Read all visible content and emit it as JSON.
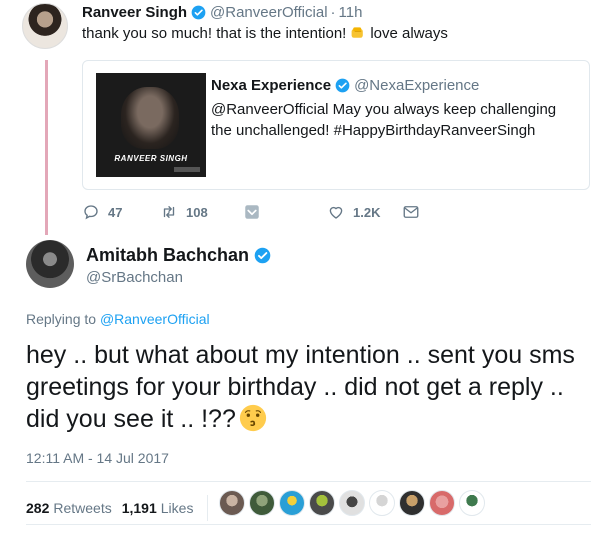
{
  "reply_tweet": {
    "name": "Ranveer Singh",
    "handle": "@RanveerOfficial",
    "separator": "·",
    "time": "11h",
    "text_before": "thank you so much! that is the intention!",
    "text_after": "love always"
  },
  "quoted_tweet": {
    "name": "Nexa Experience",
    "handle": "@NexaExperience",
    "text": "@RanveerOfficial May you always keep challenging the unchallenged! #HappyBirthdayRanveerSingh",
    "image_caption": "RANVEER SINGH"
  },
  "actions": {
    "reply_count": "47",
    "retweet_count": "108",
    "like_count": "1.2K"
  },
  "main_tweet": {
    "name": "Amitabh Bachchan",
    "handle": "@SrBachchan",
    "replying_prefix": "Replying to",
    "replying_to": "@RanveerOfficial",
    "text": "hey .. but what about my intention .. sent you sms greetings for your birthday .. did not get a reply .. did you see it .. !??",
    "timestamp": "12:11 AM - 14 Jul 2017",
    "retweets_count": "282",
    "retweets_label": "Retweets",
    "likes_count": "1,191",
    "likes_label": "Likes"
  },
  "colors": {
    "accent": "#1da1f2",
    "thread_line": "#e3a7b8",
    "muted": "#657786"
  },
  "liker_avatars": [
    "avatar-1",
    "avatar-2",
    "avatar-3",
    "avatar-4",
    "avatar-5",
    "avatar-6",
    "avatar-7",
    "avatar-8",
    "avatar-9"
  ]
}
